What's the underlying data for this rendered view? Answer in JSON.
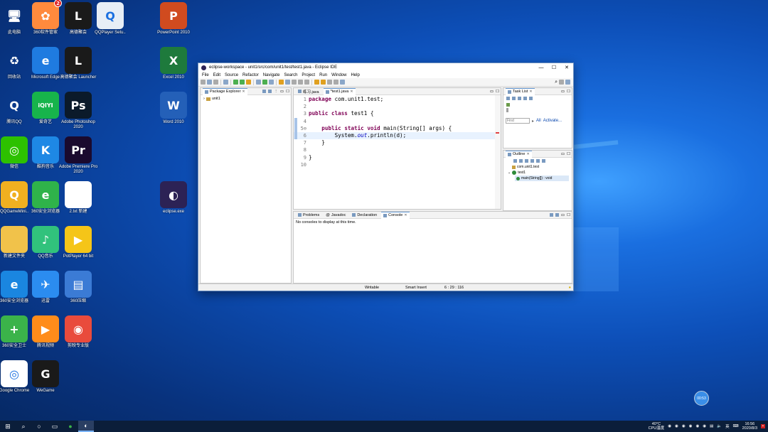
{
  "desktop": {
    "icons": [
      {
        "label": "此电脑",
        "glyph": "🖥",
        "bg": "transparent"
      },
      {
        "label": "360软件管家",
        "glyph": "✿",
        "bg": "#ff8a3d",
        "badge": "2"
      },
      {
        "label": "高德聚会",
        "glyph": "L",
        "bg": "#1a1a1a"
      },
      {
        "label": "QQPlayer Setu..",
        "glyph": "Q",
        "bg": "#e7eef6"
      },
      {
        "label": "PowerPoint 2010",
        "glyph": "P",
        "bg": "#d04b1f"
      },
      {
        "label": "回收站",
        "glyph": "♻",
        "bg": "transparent"
      },
      {
        "label": "Microsoft Edge",
        "glyph": "e",
        "bg": "#1f7be0"
      },
      {
        "label": "高德聚会 Launcher",
        "glyph": "L",
        "bg": "#1a1a1a"
      },
      {
        "label": "Excel 2010",
        "glyph": "X",
        "bg": "#1e7a3c"
      },
      {
        "label": "腾讯QQ",
        "glyph": "Q",
        "bg": "transparent"
      },
      {
        "label": "爱奇艺",
        "glyph": "iQIYI",
        "bg": "#17b44b"
      },
      {
        "label": "Adobe Photoshop 2020",
        "glyph": "Ps",
        "bg": "#0b1a2a"
      },
      {
        "label": "Word 2010",
        "glyph": "W",
        "bg": "#2460b8"
      },
      {
        "label": "微信",
        "glyph": "◎",
        "bg": "#2dc100"
      },
      {
        "label": "酷狗音乐",
        "glyph": "K",
        "bg": "#1e88e5"
      },
      {
        "label": "Adobe Premiere Pro 2020",
        "glyph": "Pr",
        "bg": "#1a0a2e"
      },
      {
        "label": "QQGameMini..",
        "glyph": "Q",
        "bg": "#f0b020"
      },
      {
        "label": "360安全浏览器",
        "glyph": "e",
        "bg": "#2fb34a"
      },
      {
        "label": "2.txt 新建",
        "glyph": "",
        "bg": "#ffffff"
      },
      {
        "label": "eclipse.exe",
        "glyph": "◐",
        "bg": "#2c2255"
      },
      {
        "label": "新建文件夹",
        "glyph": "",
        "bg": "#f1c24a"
      },
      {
        "label": "QQ音乐",
        "glyph": "♪",
        "bg": "#31c27c"
      },
      {
        "label": "PotPlayer 64 bit",
        "glyph": "▶",
        "bg": "#f5c518"
      },
      {
        "label": "360安全浏览器",
        "glyph": "e",
        "bg": "#1a86e0"
      },
      {
        "label": "迅雷",
        "glyph": "✈",
        "bg": "#2b8cf0"
      },
      {
        "label": "360压缩",
        "glyph": "▤",
        "bg": "#3b7bd5"
      },
      {
        "label": "360安全卫士",
        "glyph": "+",
        "bg": "#3bb34a"
      },
      {
        "label": "腾讯视频",
        "glyph": "▶",
        "bg": "#ff8c1a"
      },
      {
        "label": "剪映专业版",
        "glyph": "◉",
        "bg": "#e94b3c"
      },
      {
        "label": "Google Chrome",
        "glyph": "◎",
        "bg": "#ffffff"
      },
      {
        "label": "WeGame",
        "glyph": "G",
        "bg": "#1a1a1a"
      }
    ]
  },
  "eclipse": {
    "title": "eclipse-workspace - unit1/src/com/unit1/test/test1.java - Eclipse IDE",
    "menu": [
      "File",
      "Edit",
      "Source",
      "Refactor",
      "Navigate",
      "Search",
      "Project",
      "Run",
      "Window",
      "Help"
    ],
    "package_explorer": {
      "tab": "Package Explorer",
      "project": "unit1"
    },
    "editor_tabs": [
      "练习.java",
      "*test1.java"
    ],
    "code_lines": [
      {
        "n": "1",
        "text": "package com.unit1.test;"
      },
      {
        "n": "2",
        "text": ""
      },
      {
        "n": "3",
        "text": "public class test1 {"
      },
      {
        "n": "4",
        "text": ""
      },
      {
        "n": "5⊖",
        "text": "    public static void main(String[] args) {"
      },
      {
        "n": "6",
        "text": "        System.out.println(d);"
      },
      {
        "n": "7",
        "text": "    }"
      },
      {
        "n": "8",
        "text": ""
      },
      {
        "n": "9",
        "text": "}"
      },
      {
        "n": "10",
        "text": ""
      }
    ],
    "task_list": {
      "tab": "Task List",
      "find_placeholder": "Find",
      "all": "All",
      "activate": "Activate..."
    },
    "outline": {
      "tab": "Outline",
      "package": "com.unit1.test",
      "class": "test1",
      "method": "main(String[]) : void"
    },
    "bottom_tabs": [
      "Problems",
      "Javadoc",
      "Declaration",
      "Console"
    ],
    "console_message": "No consoles to display at this time.",
    "status": {
      "writable": "Writable",
      "insert": "Smart Insert",
      "position": "6 : 29 : 116"
    }
  },
  "taskbar": {
    "temp": "40°C",
    "cpu": "CPU温度",
    "lang": "英",
    "time": "16:56",
    "date": "2020/8/3"
  },
  "floating_button": "00:53"
}
